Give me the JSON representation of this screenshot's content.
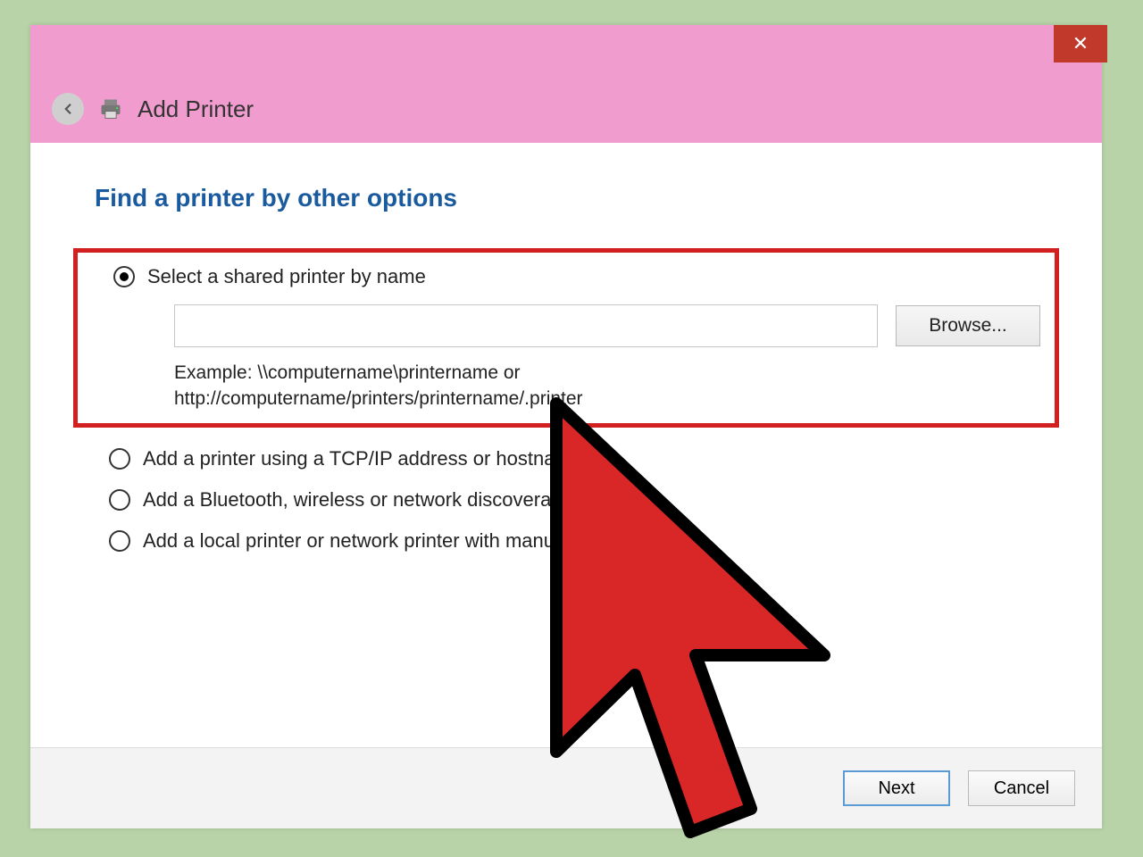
{
  "titlebar": {
    "close_label": "✕",
    "window_title": "Add Printer"
  },
  "heading": "Find a printer by other options",
  "option1": {
    "label": "Select a shared printer by name",
    "input_value": "",
    "browse_label": "Browse...",
    "example_line1": "Example: \\\\computername\\printername or",
    "example_line2": "http://computername/printers/printername/.printer"
  },
  "option2_label": "Add a printer using a TCP/IP address or hostname",
  "option3_label": "Add a Bluetooth, wireless or network discoverable printer",
  "option4_label": "Add a local printer or network printer with manual settings",
  "footer": {
    "next_label": "Next",
    "cancel_label": "Cancel"
  }
}
